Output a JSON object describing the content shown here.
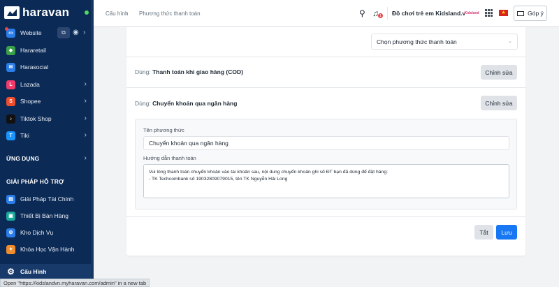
{
  "sidebar": {
    "brand": "haravan",
    "items": [
      {
        "label": "Website",
        "icon": "website-icon",
        "color": "#2b7de9"
      },
      {
        "label": "Hararetail",
        "icon": "hararetail-icon",
        "color": "#3aa14a"
      },
      {
        "label": "Harasocial",
        "icon": "harasocial-icon",
        "color": "#2b7de9"
      },
      {
        "label": "Lazada",
        "icon": "lazada-icon",
        "color": "#f23a6b"
      },
      {
        "label": "Shopee",
        "icon": "shopee-icon",
        "color": "#ee4d2d"
      },
      {
        "label": "Tiktok Shop",
        "icon": "tiktok-icon",
        "color": "#111111"
      },
      {
        "label": "Tiki",
        "icon": "tiki-icon",
        "color": "#1a94ff"
      }
    ],
    "apps_section": "ỨNG DỤNG",
    "support_section": "GIẢI PHÁP HỖ TRỢ",
    "support_items": [
      {
        "label": "Giải Pháp Tài Chính",
        "icon": "finance-icon",
        "color": "#2b7de9"
      },
      {
        "label": "Thiết Bị Bán Hàng",
        "icon": "pos-device-icon",
        "color": "#19a89b"
      },
      {
        "label": "Kho Dịch Vụ",
        "icon": "service-store-icon",
        "color": "#2b7de9"
      },
      {
        "label": "Khóa Học Vận Hành",
        "icon": "course-icon",
        "color": "#f08c2b"
      }
    ],
    "settings_label": "Cấu Hình"
  },
  "statusbar": {
    "text": "Open \"https://kidslandvn.myharavan.com/admin\" in a new tab"
  },
  "header": {
    "breadcrumb_1": "Cấu hình",
    "breadcrumb_2": "Phương thức thanh toán",
    "notification_count": "1",
    "store_name": "Đồ chơi trẻ em Kidsland.vn",
    "store_logo_text": "Kidsland",
    "feedback_label": "Góp ý"
  },
  "main": {
    "select_placeholder": "Chọn phương thức thanh toán",
    "cod_prefix": "Dùng:",
    "cod_name": "Thanh toán khi giao hàng (COD)",
    "edit_label": "Chỉnh sửa",
    "bank_prefix": "Dùng:",
    "bank_name": "Chuyển khoản qua ngân hàng",
    "method_name_label": "Tên phương thức",
    "method_name_value": "Chuyển khoản qua ngân hàng",
    "instructions_label": "Hướng dẫn thanh toán",
    "instructions_line1": "Vui lòng thanh toán chuyển khoản vào tài khoản sau, nội dung chuyển khoản ghi số ĐT bạn đã dùng để đặt hàng:",
    "instructions_line2": "- TK Techcombank số 19032809079015, tên TK Nguyễn Hải Long",
    "off_label": "Tắt",
    "save_label": "Lưu"
  },
  "colors": {
    "sidebar_bg": "#0b2a55",
    "primary": "#1877f2"
  }
}
